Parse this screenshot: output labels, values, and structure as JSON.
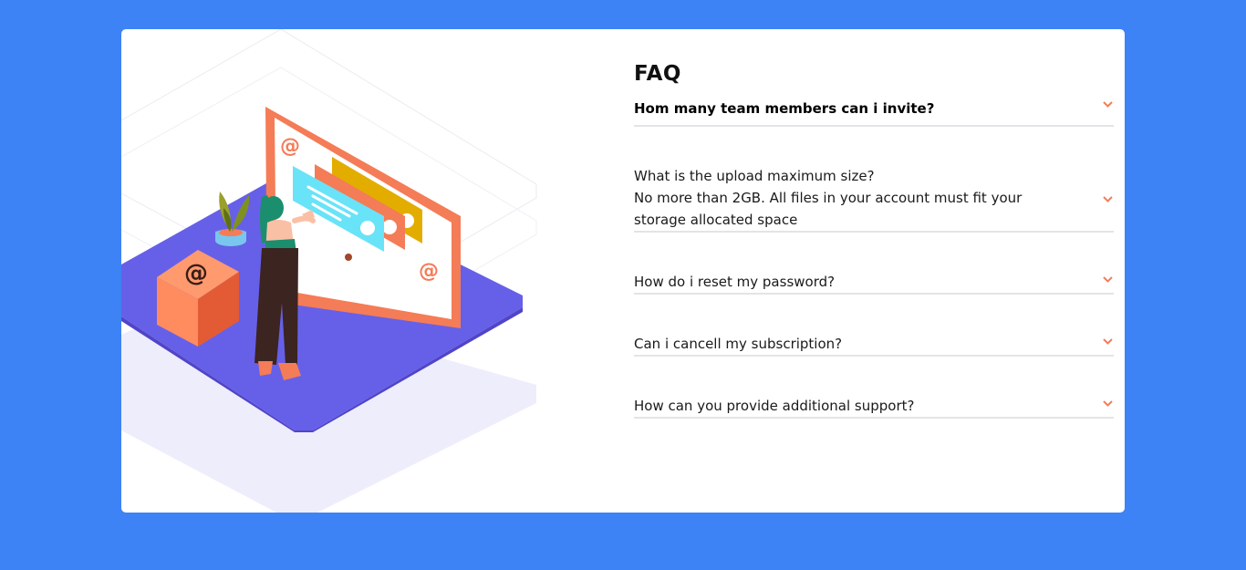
{
  "faq": {
    "title": "FAQ",
    "items": [
      {
        "question": "Hom many team members can i invite?",
        "answer": "",
        "open": true
      },
      {
        "question": "What is the upload maximum size?",
        "answer": "No more than 2GB. All files in your account must fit your storage allocated space",
        "open": false
      },
      {
        "question": "How do i reset my password?",
        "answer": "",
        "open": false
      },
      {
        "question": "Can i cancell my subscription?",
        "answer": "",
        "open": false
      },
      {
        "question": "How can you provide additional support?",
        "answer": "",
        "open": false
      }
    ]
  },
  "icons": {
    "toggle": "chevron-down-icon",
    "illustration": "woman-online-illustration"
  },
  "colors": {
    "background": "#3d83f5",
    "card": "#ffffff",
    "accent": "#f47c57",
    "divider": "#e4e4e8",
    "platform": "#6660e8"
  }
}
